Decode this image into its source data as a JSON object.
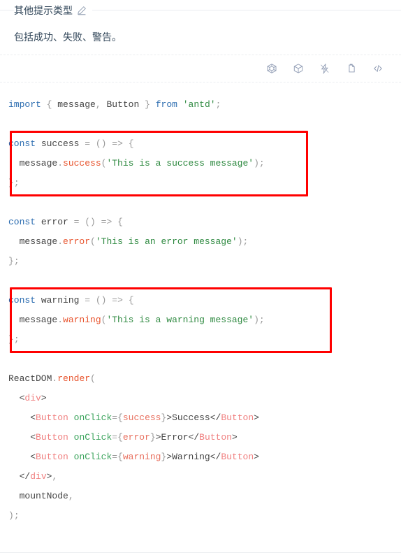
{
  "card": {
    "title": "其他提示类型",
    "description": "包括成功、失败、警告。",
    "edit_icon": "pencil-edit-icon"
  },
  "actions": [
    {
      "name": "codesandbox-icon",
      "label": "在 CodeSandbox 中打开"
    },
    {
      "name": "codepen-icon",
      "label": "在 CodePen 中打开"
    },
    {
      "name": "riddle-icon",
      "label": "在 Riddle 中打开"
    },
    {
      "name": "copy-icon",
      "label": "复制代码"
    },
    {
      "name": "code-brackets-icon",
      "label": "显示代码"
    }
  ],
  "code": {
    "language": "jsx",
    "lines": [
      {
        "id": "l1",
        "tokens": [
          {
            "t": "import",
            "c": "tok-keyword"
          },
          {
            "t": " ",
            "c": "tok-plain"
          },
          {
            "t": "{",
            "c": "tok-punct"
          },
          {
            "t": " message",
            "c": "tok-plain"
          },
          {
            "t": ",",
            "c": "tok-punct"
          },
          {
            "t": " Button ",
            "c": "tok-plain"
          },
          {
            "t": "}",
            "c": "tok-punct"
          },
          {
            "t": " ",
            "c": "tok-plain"
          },
          {
            "t": "from",
            "c": "tok-keyword"
          },
          {
            "t": " ",
            "c": "tok-plain"
          },
          {
            "t": "'antd'",
            "c": "tok-string"
          },
          {
            "t": ";",
            "c": "tok-punct"
          }
        ]
      },
      {
        "id": "l2",
        "tokens": []
      },
      {
        "id": "l3",
        "tokens": [
          {
            "t": "const",
            "c": "tok-keyword"
          },
          {
            "t": " success ",
            "c": "tok-plain"
          },
          {
            "t": "=",
            "c": "tok-punct"
          },
          {
            "t": " ",
            "c": "tok-plain"
          },
          {
            "t": "()",
            "c": "tok-punct"
          },
          {
            "t": " ",
            "c": "tok-plain"
          },
          {
            "t": "=>",
            "c": "tok-punct"
          },
          {
            "t": " ",
            "c": "tok-plain"
          },
          {
            "t": "{",
            "c": "tok-punct"
          }
        ]
      },
      {
        "id": "l4",
        "tokens": [
          {
            "t": "  message",
            "c": "tok-plain"
          },
          {
            "t": ".",
            "c": "tok-punct"
          },
          {
            "t": "success",
            "c": "tok-method"
          },
          {
            "t": "(",
            "c": "tok-punct"
          },
          {
            "t": "'This is a success message'",
            "c": "tok-string"
          },
          {
            "t": ")",
            "c": "tok-punct"
          },
          {
            "t": ";",
            "c": "tok-punct"
          }
        ]
      },
      {
        "id": "l5",
        "tokens": [
          {
            "t": "}",
            "c": "tok-punct"
          },
          {
            "t": ";",
            "c": "tok-punct"
          }
        ]
      },
      {
        "id": "l6",
        "tokens": []
      },
      {
        "id": "l7",
        "tokens": [
          {
            "t": "const",
            "c": "tok-keyword"
          },
          {
            "t": " error ",
            "c": "tok-plain"
          },
          {
            "t": "=",
            "c": "tok-punct"
          },
          {
            "t": " ",
            "c": "tok-plain"
          },
          {
            "t": "()",
            "c": "tok-punct"
          },
          {
            "t": " ",
            "c": "tok-plain"
          },
          {
            "t": "=>",
            "c": "tok-punct"
          },
          {
            "t": " ",
            "c": "tok-plain"
          },
          {
            "t": "{",
            "c": "tok-punct"
          }
        ]
      },
      {
        "id": "l8",
        "tokens": [
          {
            "t": "  message",
            "c": "tok-plain"
          },
          {
            "t": ".",
            "c": "tok-punct"
          },
          {
            "t": "error",
            "c": "tok-method"
          },
          {
            "t": "(",
            "c": "tok-punct"
          },
          {
            "t": "'This is an error message'",
            "c": "tok-string"
          },
          {
            "t": ")",
            "c": "tok-punct"
          },
          {
            "t": ";",
            "c": "tok-punct"
          }
        ]
      },
      {
        "id": "l9",
        "tokens": [
          {
            "t": "}",
            "c": "tok-punct"
          },
          {
            "t": ";",
            "c": "tok-punct"
          }
        ]
      },
      {
        "id": "l10",
        "tokens": []
      },
      {
        "id": "l11",
        "tokens": [
          {
            "t": "const",
            "c": "tok-keyword"
          },
          {
            "t": " warning ",
            "c": "tok-plain"
          },
          {
            "t": "=",
            "c": "tok-punct"
          },
          {
            "t": " ",
            "c": "tok-plain"
          },
          {
            "t": "()",
            "c": "tok-punct"
          },
          {
            "t": " ",
            "c": "tok-plain"
          },
          {
            "t": "=>",
            "c": "tok-punct"
          },
          {
            "t": " ",
            "c": "tok-plain"
          },
          {
            "t": "{",
            "c": "tok-punct"
          }
        ]
      },
      {
        "id": "l12",
        "tokens": [
          {
            "t": "  message",
            "c": "tok-plain"
          },
          {
            "t": ".",
            "c": "tok-punct"
          },
          {
            "t": "warning",
            "c": "tok-method"
          },
          {
            "t": "(",
            "c": "tok-punct"
          },
          {
            "t": "'This is a warning message'",
            "c": "tok-string"
          },
          {
            "t": ")",
            "c": "tok-punct"
          },
          {
            "t": ";",
            "c": "tok-punct"
          }
        ]
      },
      {
        "id": "l13",
        "tokens": [
          {
            "t": "}",
            "c": "tok-punct"
          },
          {
            "t": ";",
            "c": "tok-punct"
          }
        ]
      },
      {
        "id": "l14",
        "tokens": []
      },
      {
        "id": "l15",
        "tokens": [
          {
            "t": "ReactDOM",
            "c": "tok-plain"
          },
          {
            "t": ".",
            "c": "tok-punct"
          },
          {
            "t": "render",
            "c": "tok-method"
          },
          {
            "t": "(",
            "c": "tok-punct"
          }
        ]
      },
      {
        "id": "l16",
        "tokens": [
          {
            "t": "  <",
            "c": "tok-plain"
          },
          {
            "t": "div",
            "c": "tok-tag"
          },
          {
            "t": ">",
            "c": "tok-plain"
          }
        ]
      },
      {
        "id": "l17",
        "tokens": [
          {
            "t": "    <",
            "c": "tok-plain"
          },
          {
            "t": "Button",
            "c": "tok-tag"
          },
          {
            "t": " ",
            "c": "tok-plain"
          },
          {
            "t": "onClick",
            "c": "tok-attr"
          },
          {
            "t": "=",
            "c": "tok-punct"
          },
          {
            "t": "{",
            "c": "tok-brace"
          },
          {
            "t": "success",
            "c": "tok-var"
          },
          {
            "t": "}",
            "c": "tok-brace"
          },
          {
            "t": ">",
            "c": "tok-plain"
          },
          {
            "t": "Success",
            "c": "tok-plain"
          },
          {
            "t": "</",
            "c": "tok-plain"
          },
          {
            "t": "Button",
            "c": "tok-tag"
          },
          {
            "t": ">",
            "c": "tok-plain"
          }
        ]
      },
      {
        "id": "l18",
        "tokens": [
          {
            "t": "    <",
            "c": "tok-plain"
          },
          {
            "t": "Button",
            "c": "tok-tag"
          },
          {
            "t": " ",
            "c": "tok-plain"
          },
          {
            "t": "onClick",
            "c": "tok-attr"
          },
          {
            "t": "=",
            "c": "tok-punct"
          },
          {
            "t": "{",
            "c": "tok-brace"
          },
          {
            "t": "error",
            "c": "tok-var"
          },
          {
            "t": "}",
            "c": "tok-brace"
          },
          {
            "t": ">",
            "c": "tok-plain"
          },
          {
            "t": "Error",
            "c": "tok-plain"
          },
          {
            "t": "</",
            "c": "tok-plain"
          },
          {
            "t": "Button",
            "c": "tok-tag"
          },
          {
            "t": ">",
            "c": "tok-plain"
          }
        ]
      },
      {
        "id": "l19",
        "tokens": [
          {
            "t": "    <",
            "c": "tok-plain"
          },
          {
            "t": "Button",
            "c": "tok-tag"
          },
          {
            "t": " ",
            "c": "tok-plain"
          },
          {
            "t": "onClick",
            "c": "tok-attr"
          },
          {
            "t": "=",
            "c": "tok-punct"
          },
          {
            "t": "{",
            "c": "tok-brace"
          },
          {
            "t": "warning",
            "c": "tok-var"
          },
          {
            "t": "}",
            "c": "tok-brace"
          },
          {
            "t": ">",
            "c": "tok-plain"
          },
          {
            "t": "Warning",
            "c": "tok-plain"
          },
          {
            "t": "</",
            "c": "tok-plain"
          },
          {
            "t": "Button",
            "c": "tok-tag"
          },
          {
            "t": ">",
            "c": "tok-plain"
          }
        ]
      },
      {
        "id": "l20",
        "tokens": [
          {
            "t": "  </",
            "c": "tok-plain"
          },
          {
            "t": "div",
            "c": "tok-tag"
          },
          {
            "t": ">",
            "c": "tok-plain"
          },
          {
            "t": ",",
            "c": "tok-punct"
          }
        ]
      },
      {
        "id": "l21",
        "tokens": [
          {
            "t": "  mountNode",
            "c": "tok-plain"
          },
          {
            "t": ",",
            "c": "tok-punct"
          }
        ]
      },
      {
        "id": "l22",
        "tokens": [
          {
            "t": ")",
            "c": "tok-punct"
          },
          {
            "t": ";",
            "c": "tok-punct"
          }
        ]
      }
    ]
  },
  "annotations": [
    {
      "id": "hl-success",
      "target": "success-handler-block",
      "color": "#ff0000"
    },
    {
      "id": "hl-warning",
      "target": "warning-handler-block",
      "color": "#ff0000"
    }
  ]
}
